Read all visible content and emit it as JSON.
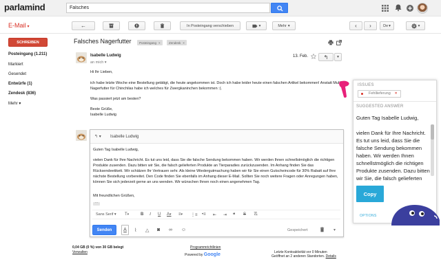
{
  "header": {
    "logo": "parlamind",
    "search_value": "Falsches",
    "icons": {
      "search": "search-icon",
      "apps": "apps-grid-icon",
      "notifications": "bell-icon",
      "share": "share-plus-icon",
      "avatar": "user-avatar"
    }
  },
  "toolbar": {
    "app_title": "E-Mail",
    "move_label": "In Posteingang verschieben",
    "more_label": "Mehr",
    "lang_label": "De"
  },
  "sidebar": {
    "compose_label": "SCHREIBEN",
    "items": [
      {
        "label": "Posteingang (1.211)",
        "bold": true
      },
      {
        "label": "Markiert",
        "bold": false
      },
      {
        "label": "Gesendet",
        "bold": false
      },
      {
        "label": "Entwürfe (1)",
        "bold": true
      },
      {
        "label": "Zendesk (836)",
        "bold": true
      },
      {
        "label": "Mehr",
        "bold": false
      }
    ]
  },
  "message": {
    "subject": "Falsches Nagerfutter",
    "tags": [
      "Posteingang",
      "Zendesk"
    ],
    "sender": "Isabelle Ludwig",
    "to": "an mich",
    "date": "13. Feb.",
    "body": [
      "Hi Ihr Lieben,",
      "ich habe letzte Woche eine Bestellung getätigt, die heute angekommen ist. Doch ich habe leider heute einen falschen Artikel bekommen! Anstatt MultiFit Nagerfutter für Chinchilas habe ich welches für Zwergkaninchen bekommen :(.",
      "Was passiert jetzt am besten?",
      "Beste Grüße,",
      "Isabelle Ludwig"
    ]
  },
  "reply": {
    "to": "Isabelle Ludwig",
    "body": [
      "Guten Tag Isabelle Ludwig,",
      "vielen Dank für Ihre Nachricht. Es tut uns leid, dass Sie die falsche Sendung bekommen haben. Wir werden Ihnen schnellstmöglich die richtigen Produkte zusenden. Dazu bitten wir Sie, die falsch gelieferten Produkte an Tierparadies zurückzusenden. Im Anhang finden Sie das Rücksendeetikett. Wir schätzen Ihr Vertrauen sehr. Als kleine Wiedergutmachung haben wir für Sie einen Gutscheincode für 30% Rabatt auf Ihre nächste Bestellung vorbereitet. Den Code finden Sie ebenfalls im Anhang dieser E-Mail. Sollten Sie noch weitere Fragen oder Anregungen haben, können Sie sich jederzeit gerne an uns wenden. Wir wünschen Ihnen noch einen angenehmen Tag.",
      "Mit freundlichen Grüßen,"
    ],
    "quote_dots": "···",
    "font_label": "Sans Serif",
    "send_label": "Senden",
    "saved_label": "Gespeichert"
  },
  "footer": {
    "storage": "0,04 GB (0 %) von 30 GB belegt",
    "manage": "Verwalten",
    "policies": "Programmrichtlinien",
    "powered": "Powered by",
    "google": "Google",
    "activity": "Letzte Kontoaktivität vor 0 Minuten",
    "open_elsewhere": "Geöffnet an 2 anderen Standorten.",
    "details": "Details"
  },
  "panel": {
    "issues_heading": "ISSUES",
    "issue": "Fehllieferung",
    "issue_remove": "×",
    "suggested_heading": "SUGGESTED ANSWER",
    "suggested_text": "Guten Tag Isabelle Ludwig,\n\nvielen Dank für Ihre Nachricht. Es tut uns leid, dass Sie die falsche Sendung bekommen haben. Wir werden Ihnen schnellstmöglich die richtigen Produkte zusenden. Dazu bitten wir Sie, die falsch gelieferten Produkte an Tierparadies zurückzusenden. Im Anhang finden Sie das Rücksendeetikett.",
    "copy_label": "Copy",
    "options_label": "OPTIONS"
  },
  "colors": {
    "accent_red": "#d14836",
    "brand_blue": "#4285f4",
    "panel_blue": "#29a8d8",
    "pink": "#e8217a",
    "blob_navy": "#3b3f9e"
  }
}
